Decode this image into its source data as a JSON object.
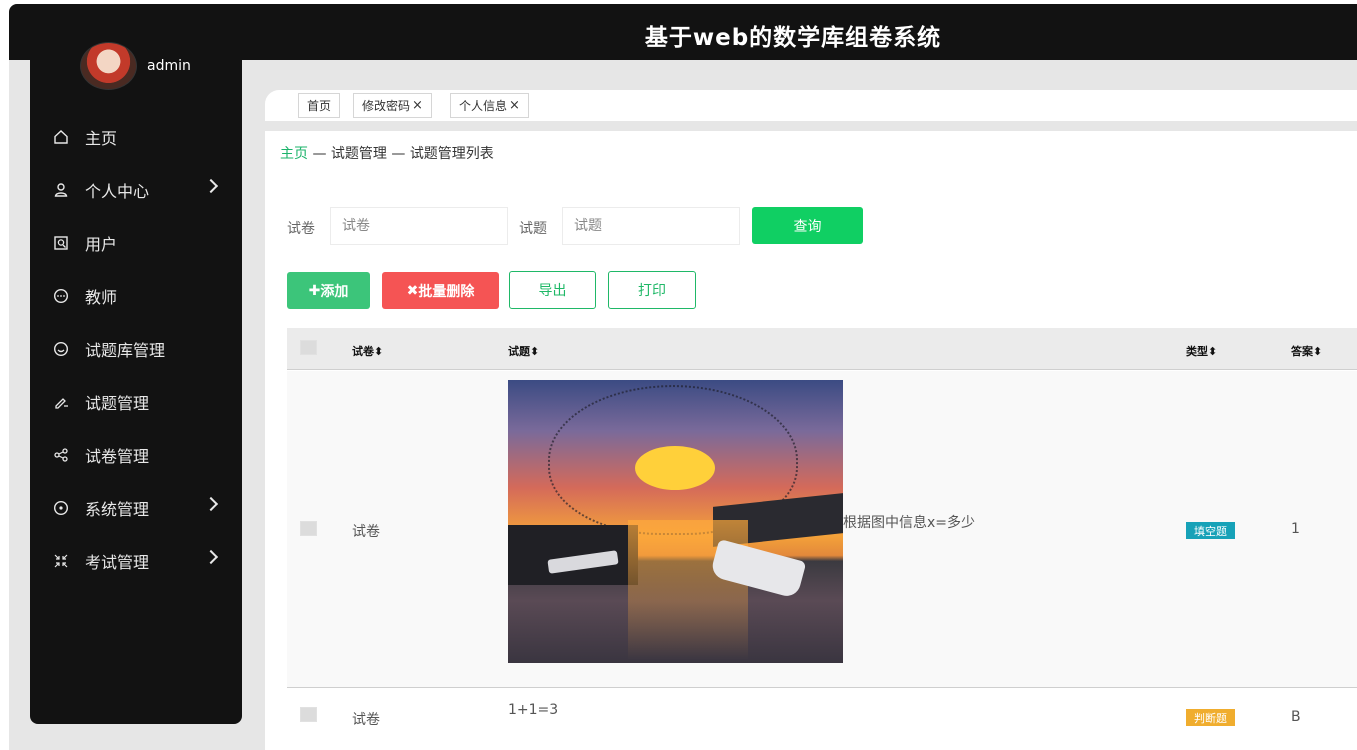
{
  "header": {
    "title": "基于web的数学库组卷系统"
  },
  "user": {
    "name": "admin"
  },
  "sidebar": {
    "items": [
      {
        "label": "主页",
        "icon": "home-icon",
        "has_arrow": false
      },
      {
        "label": "个人中心",
        "icon": "user-icon",
        "has_arrow": true
      },
      {
        "label": "用户",
        "icon": "user-search-icon",
        "has_arrow": false
      },
      {
        "label": "教师",
        "icon": "more-circle-icon",
        "has_arrow": false
      },
      {
        "label": "试题库管理",
        "icon": "smile-icon",
        "has_arrow": false
      },
      {
        "label": "试题管理",
        "icon": "edit-icon",
        "has_arrow": false
      },
      {
        "label": "试卷管理",
        "icon": "share-icon",
        "has_arrow": false
      },
      {
        "label": "系统管理",
        "icon": "target-icon",
        "has_arrow": true
      },
      {
        "label": "考试管理",
        "icon": "shrink-icon",
        "has_arrow": true
      }
    ]
  },
  "tabs": [
    {
      "label": "首页",
      "closable": false
    },
    {
      "label": "修改密码",
      "closable": true
    },
    {
      "label": "个人信息",
      "closable": true
    }
  ],
  "tab_close_glyph": "×",
  "breadcrumb": {
    "home": "主页",
    "sep": " — ",
    "level1": "试题管理",
    "level2": "试题管理列表"
  },
  "search": {
    "paper_label": "试卷",
    "paper_placeholder": "试卷",
    "question_label": "试题",
    "question_placeholder": "试题",
    "query_button": "查询"
  },
  "actions": {
    "add": "添加",
    "add_glyph": "✚",
    "batch_delete": "批量删除",
    "batch_delete_glyph": "✖",
    "export": "导出",
    "print": "打印"
  },
  "table": {
    "columns": [
      "试卷",
      "试题",
      "类型",
      "答案"
    ],
    "sort_glyph": "⬍",
    "rows": [
      {
        "paper": "试卷",
        "question": "根据图中信息x=多少",
        "has_image": true,
        "type": "填空题",
        "type_color": "#17a2b8",
        "answer": "1"
      },
      {
        "paper": "试卷",
        "question": "1+1=3",
        "has_image": false,
        "type": "判断题",
        "type_color": "#f0ad2e",
        "answer": "B"
      }
    ]
  },
  "colors": {
    "accent_green": "#10cf63",
    "danger_red": "#f55454",
    "sidebar_bg": "#121212"
  }
}
